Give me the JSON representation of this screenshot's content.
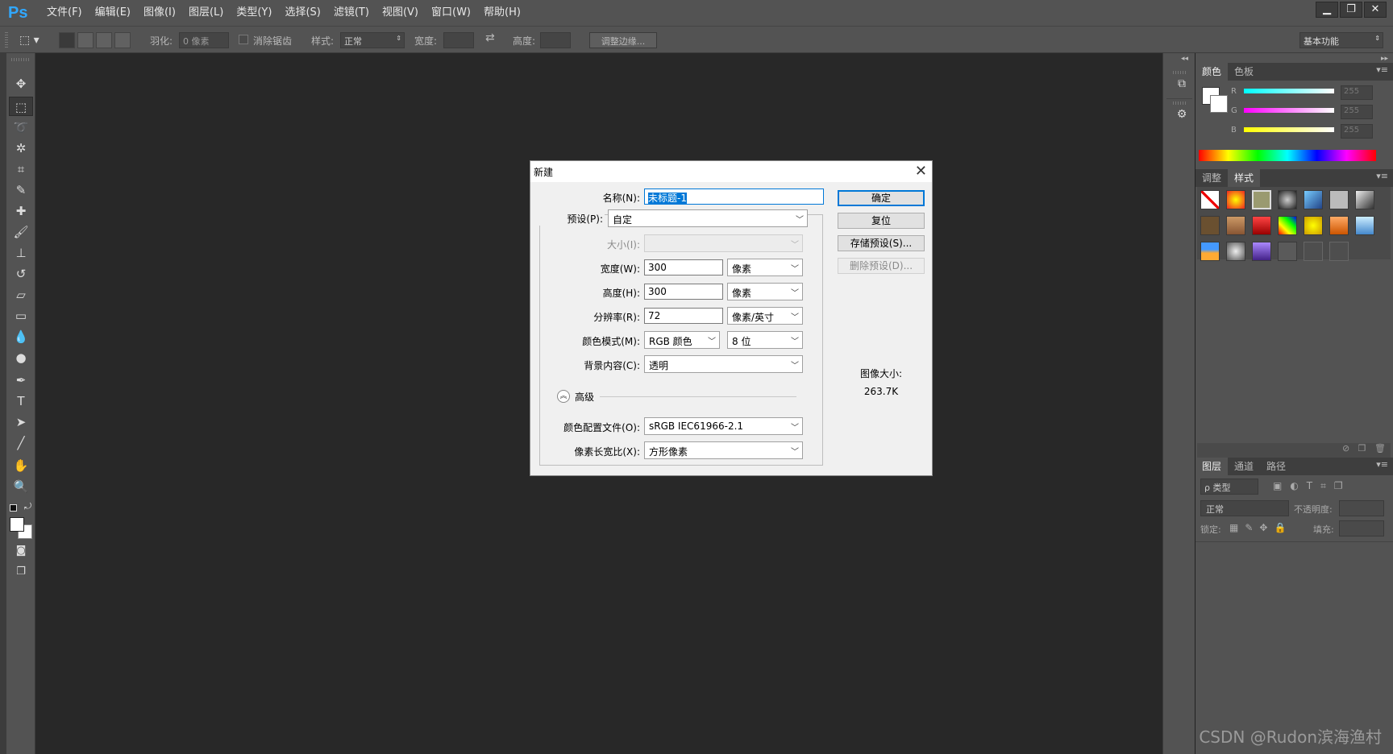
{
  "app": {
    "logo": "Ps"
  },
  "menubar": {
    "items": [
      "文件(F)",
      "编辑(E)",
      "图像(I)",
      "图层(L)",
      "类型(Y)",
      "选择(S)",
      "滤镜(T)",
      "视图(V)",
      "窗口(W)",
      "帮助(H)"
    ]
  },
  "window_controls": {
    "minimize": "▁",
    "restore": "❐",
    "close": "✕"
  },
  "options_bar": {
    "feather_label": "羽化:",
    "feather_placeholder": "0 像素",
    "antialias_label": "消除锯齿",
    "style_label": "样式:",
    "style_value": "正常",
    "width_label": "宽度:",
    "height_label": "高度:",
    "refine_edge": "调整边缘...",
    "workspace": "基本功能"
  },
  "color_panel": {
    "tabs": [
      "颜色",
      "色板"
    ],
    "channels": [
      {
        "label": "R",
        "value": "255"
      },
      {
        "label": "G",
        "value": "255"
      },
      {
        "label": "B",
        "value": "255"
      }
    ]
  },
  "styles_panel": {
    "tabs": [
      "调整",
      "样式"
    ]
  },
  "layers_panel": {
    "tabs": [
      "图层",
      "通道",
      "路径"
    ],
    "filter": "ρ 类型",
    "blend_mode": "正常",
    "opacity_label": "不透明度:",
    "lock_label": "锁定:",
    "fill_label": "填充:"
  },
  "dialog": {
    "title": "新建",
    "name_label": "名称(N):",
    "name_value": "未标题-1",
    "preset_label": "预设(P):",
    "preset_value": "自定",
    "size_label": "大小(I):",
    "width_label": "宽度(W):",
    "width_value": "300",
    "width_unit": "像素",
    "height_label": "高度(H):",
    "height_value": "300",
    "height_unit": "像素",
    "resolution_label": "分辨率(R):",
    "resolution_value": "72",
    "resolution_unit": "像素/英寸",
    "colormode_label": "颜色模式(M):",
    "colormode_value": "RGB 颜色",
    "bitdepth_value": "8 位",
    "background_label": "背景内容(C):",
    "background_value": "透明",
    "advanced_label": "高级",
    "profile_label": "颜色配置文件(O):",
    "profile_value": "sRGB IEC61966-2.1",
    "aspect_label": "像素长宽比(X):",
    "aspect_value": "方形像素",
    "ok": "确定",
    "reset": "复位",
    "save_preset": "存储预设(S)...",
    "delete_preset": "删除预设(D)...",
    "image_size_label": "图像大小:",
    "image_size_value": "263.7K"
  },
  "watermark": "CSDN @Rudon滨海渔村",
  "colors": {
    "accent": "#0078d7",
    "ps_blue": "#31a8ff",
    "panel": "#535353",
    "canvas": "#282828"
  }
}
